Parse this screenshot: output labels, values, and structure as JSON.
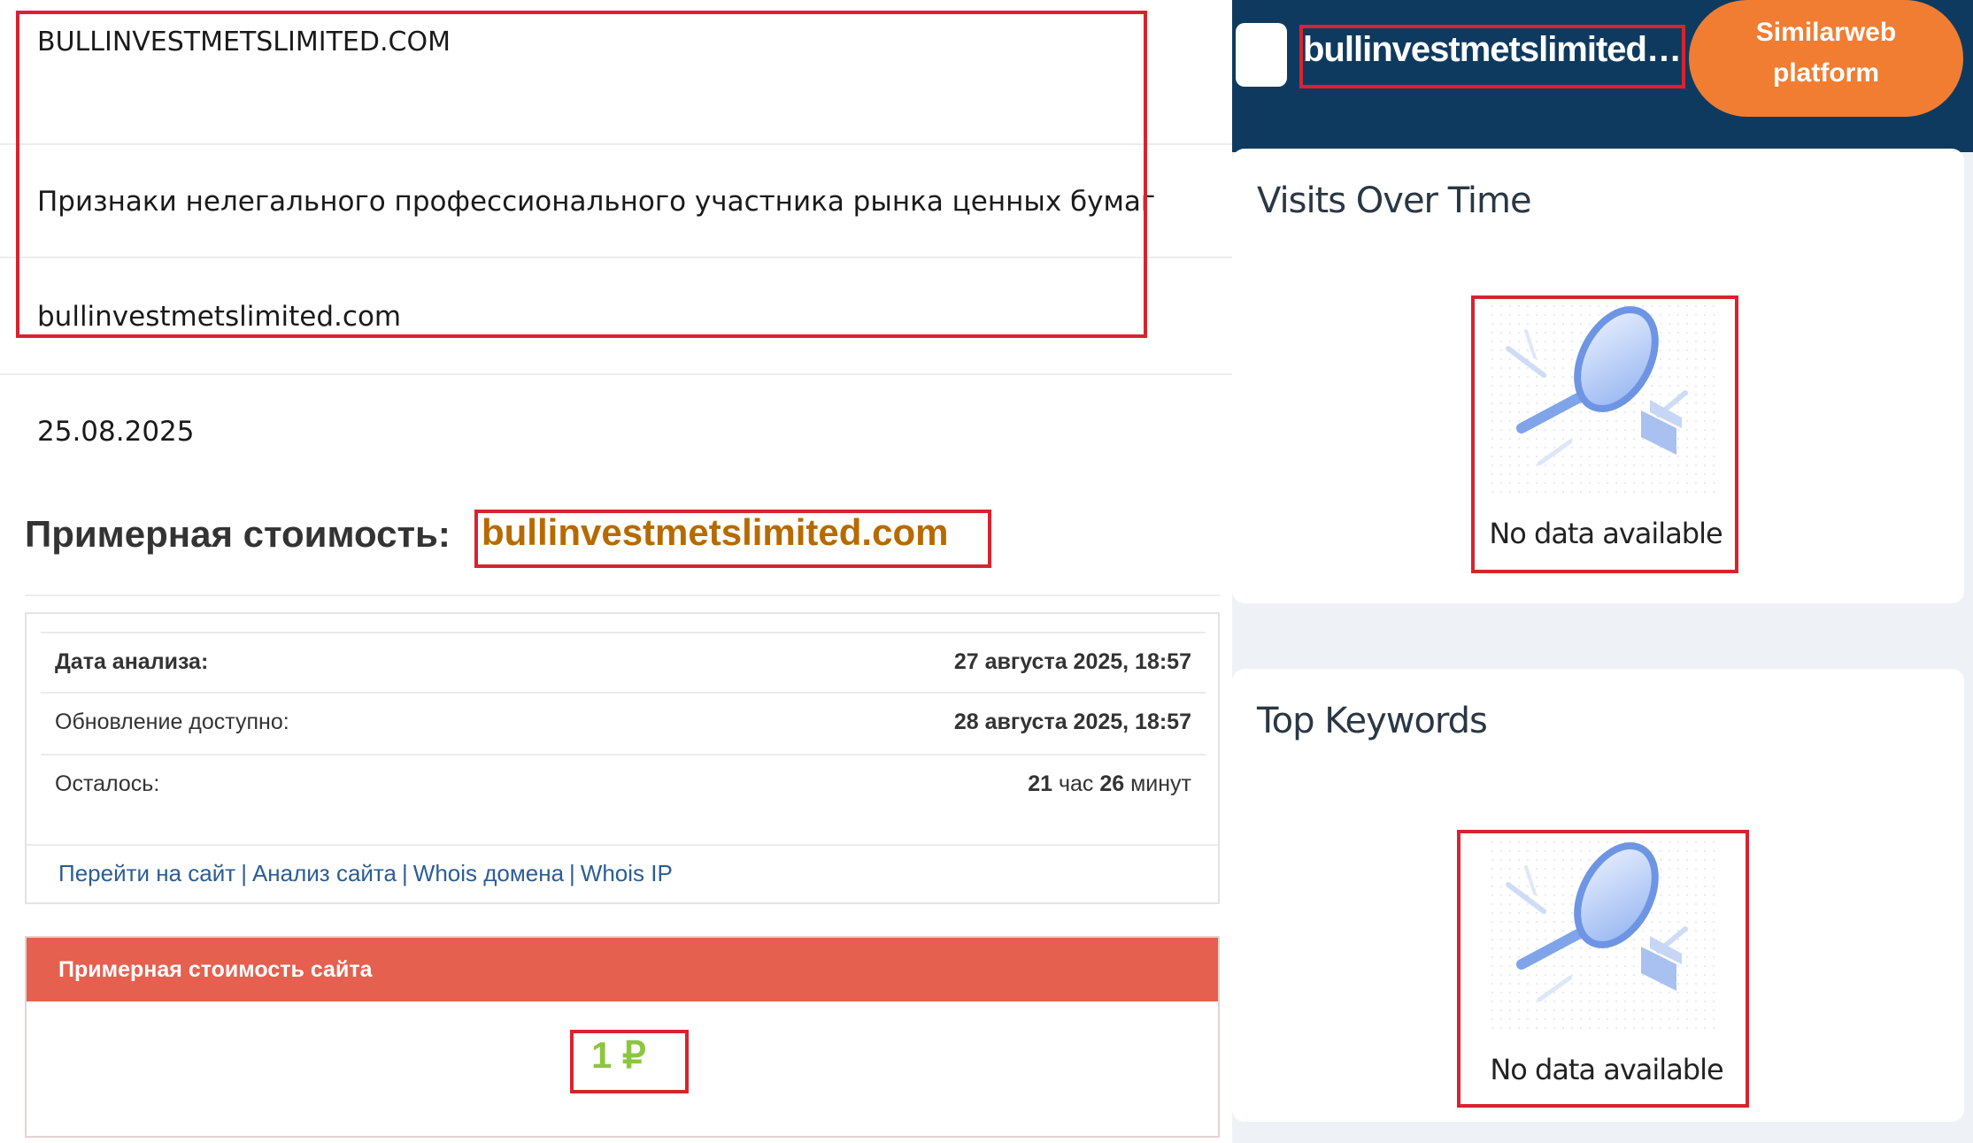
{
  "left": {
    "header_domain": "BULLINVESTMETSLIMITED.COM",
    "warning": "Признаки нелегального профессионального участника рынка ценных бумаг",
    "domain": "bullinvestmetslimited.com",
    "date": "25.08.2025",
    "estimate_title": "Примерная стоимость:",
    "estimate_domain": "bullinvestmetslimited.com",
    "info": {
      "rows": [
        {
          "label": "Дата анализа:",
          "value": "27 августа 2025, 18:57"
        },
        {
          "label": "Обновление доступно:",
          "value": "28 августа 2025, 18:57"
        },
        {
          "label": "Осталось:",
          "value_num1": "21",
          "value_unit1": " час ",
          "value_num2": "26",
          "value_unit2": " минут"
        }
      ],
      "links": [
        "Перейти на сайт",
        "Анализ сайта",
        "Whois домена",
        "Whois IP"
      ],
      "link_separator": "|"
    },
    "price": {
      "header": "Примерная стоимость сайта",
      "value": "1 ₽"
    }
  },
  "right": {
    "site_title": "bullinvestmetslimited.c...",
    "platform_button": {
      "line1": "Similarweb",
      "line2": "platform"
    },
    "cards": [
      {
        "title": "Visits Over Time",
        "empty_text": "No data available",
        "icon": "magnifier-illustration"
      },
      {
        "title": "Top Keywords",
        "empty_text": "No data available",
        "icon": "magnifier-illustration"
      }
    ]
  },
  "colors": {
    "highlight_border": "#d8232f",
    "domain_text": "#b66a00",
    "price_header": "#e5604f",
    "price_value": "#8cc63f",
    "link": "#2b5d95",
    "topbar": "#0f3a5f",
    "platform_button": "#f07d32"
  }
}
